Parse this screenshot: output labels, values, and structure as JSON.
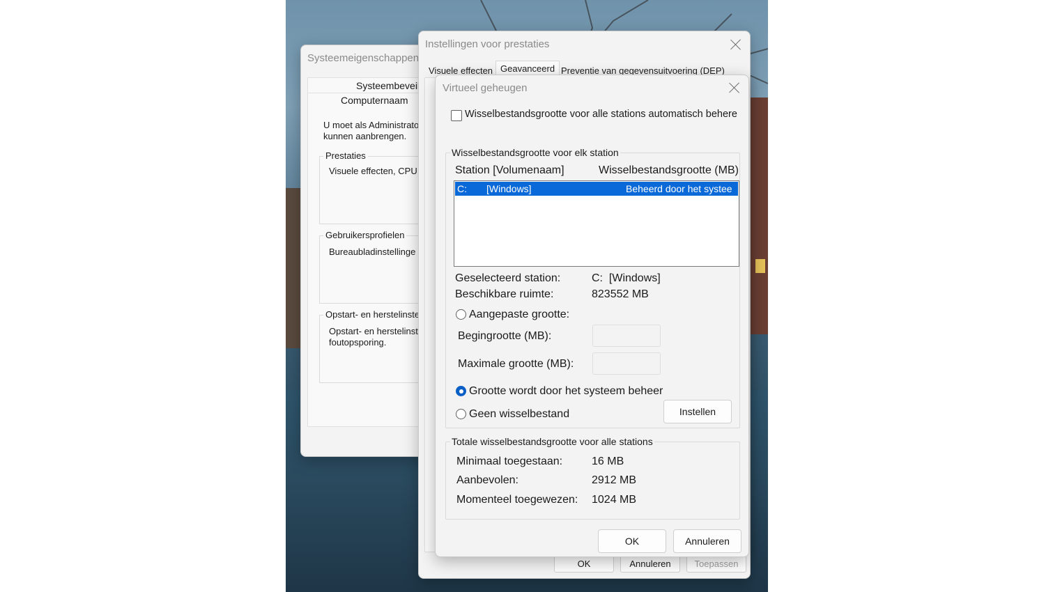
{
  "system_properties": {
    "title": "Systeemeigenschappen",
    "tab_top": "Systeembeveil",
    "tab_bottom": "Computernaam",
    "intro_line1": "U moet als Administrato",
    "intro_line2": "kunnen aanbrengen.",
    "groups": [
      {
        "title": "Prestaties",
        "text1": "Visuele effecten, CPU",
        "text2": ""
      },
      {
        "title": "Gebruikersprofielen",
        "text1": "Bureaubladinstellinge",
        "text2": ""
      },
      {
        "title": "Opstart- en herstelinste",
        "text1": "Opstart- en herstelinst",
        "text2": "foutopsporing."
      }
    ]
  },
  "performance_settings": {
    "title": "Instellingen voor prestaties",
    "tabs": [
      "Visuele effecten",
      "Geavanceerd",
      "Preventie van gegevensuitvoering (DEP)"
    ],
    "active_tab": "Geavanceerd",
    "buttons": {
      "ok": "OK",
      "cancel": "Annuleren",
      "apply": "Toepassen"
    }
  },
  "virtual_memory": {
    "title": "Virtueel geheugen",
    "auto_manage_label": "Wisselbestandsgrootte voor alle stations automatisch behere",
    "auto_manage_checked": false,
    "per_station_group": "Wisselbestandsgrootte voor elk station",
    "col_station": "Station [Volumenaam]",
    "col_size": "Wisselbestandsgrootte (MB)",
    "stations": [
      {
        "drive": "C:",
        "volume": "[Windows]",
        "size": "Beheerd door het systee",
        "selected": true
      }
    ],
    "selected_station_label": "Geselecteerd station:",
    "selected_station_value": "C:  [Windows]",
    "available_space_label": "Beschikbare ruimte:",
    "available_space_value": "823552 MB",
    "custom_size_label": "Aangepaste grootte:",
    "initial_size_label": "Begingrootte (MB):",
    "max_size_label": "Maximale grootte (MB):",
    "initial_size_value": "",
    "max_size_value": "",
    "system_managed_label": "Grootte wordt door het systeem beheer",
    "no_paging_label": "Geen wisselbestand",
    "selected_option": "system_managed",
    "set_button": "Instellen",
    "totals_group": "Totale wisselbestandsgrootte voor alle stations",
    "totals": [
      {
        "label": "Minimaal toegestaan:",
        "value": "16 MB"
      },
      {
        "label": "Aanbevolen:",
        "value": "2912 MB"
      },
      {
        "label": "Momenteel toegewezen:",
        "value": "1024 MB"
      }
    ],
    "ok_button": "OK",
    "cancel_button": "Annuleren"
  }
}
